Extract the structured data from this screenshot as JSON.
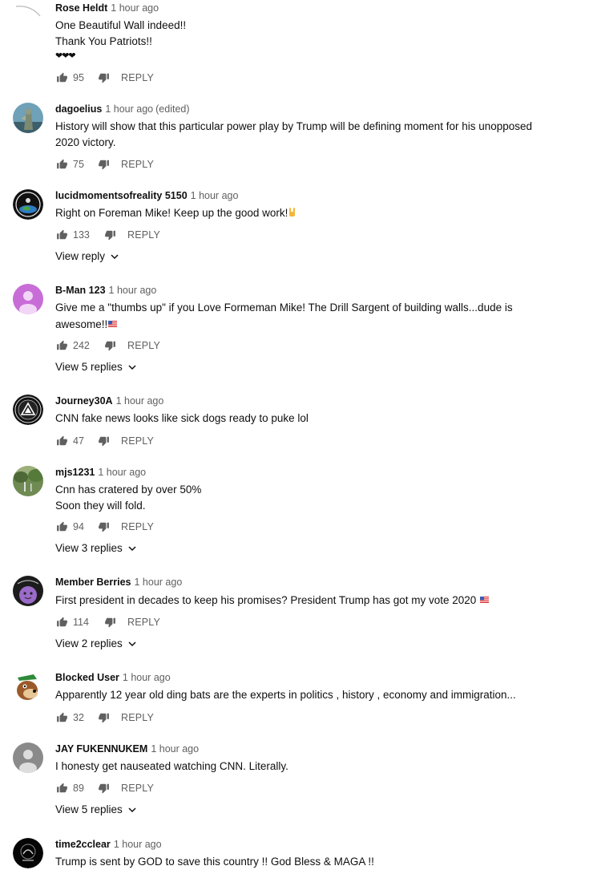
{
  "comments": [
    {
      "author": "Rose Heldt",
      "time": "1 hour ago",
      "edited": "",
      "lines": [
        "One Beautiful Wall indeed!!",
        "Thank You Patriots!!",
        "❤❤❤"
      ],
      "likes": "95",
      "reply_label": "REPLY",
      "view_replies": "",
      "avatar_icon": "partial-avatar-arc-icon"
    },
    {
      "author": "dagoelius",
      "time": "1 hour ago",
      "edited": "(edited)",
      "lines": [
        "History will show that this particular power play by Trump will be defining moment for his unopposed",
        "2020 victory."
      ],
      "likes": "75",
      "reply_label": "REPLY",
      "view_replies": "",
      "avatar_icon": "statue-photo-avatar"
    },
    {
      "author": "lucidmomentsofreality 5150",
      "time": "1 hour ago",
      "edited": "",
      "lines": [
        "Right on Foreman Mike! Keep up the good work!"
      ],
      "likes": "133",
      "reply_label": "REPLY",
      "view_replies": "View reply",
      "avatar_icon": "earth-logo-avatar"
    },
    {
      "author": "B-Man 123",
      "time": "1 hour ago",
      "edited": "",
      "lines": [
        "Give me a \"thumbs up\" if you Love Formeman Mike!  The Drill Sargent of building walls...dude is",
        "awesome!!"
      ],
      "likes": "242",
      "reply_label": "REPLY",
      "view_replies": "View 5 replies",
      "avatar_icon": "default-purple-avatar"
    },
    {
      "author": "Journey30A",
      "time": "1 hour ago",
      "edited": "",
      "lines": [
        "CNN fake news looks like sick dogs ready to puke lol"
      ],
      "likes": "47",
      "reply_label": "REPLY",
      "view_replies": "",
      "avatar_icon": "triangle-badge-avatar"
    },
    {
      "author": "mjs1231",
      "time": "1 hour ago",
      "edited": "",
      "lines": [
        "Cnn has cratered by over 50%",
        "Soon they will fold."
      ],
      "likes": "94",
      "reply_label": "REPLY",
      "view_replies": "View 3 replies",
      "avatar_icon": "landscape-photo-avatar"
    },
    {
      "author": "Member Berries",
      "time": "1 hour ago",
      "edited": "",
      "lines": [
        "First president in decades to keep his promises? President Trump has got my vote 2020"
      ],
      "likes": "114",
      "reply_label": "REPLY",
      "view_replies": "View 2 replies",
      "avatar_icon": "purple-berry-avatar"
    },
    {
      "author": "Blocked User",
      "time": "1 hour ago",
      "edited": "",
      "lines": [
        "Apparently 12 year old ding bats are the experts in politics , history , economy and immigration..."
      ],
      "likes": "32",
      "reply_label": "REPLY",
      "view_replies": "",
      "avatar_icon": "cartoon-bear-avatar"
    },
    {
      "author": "JAY FUKENNUKEM",
      "time": "1 hour ago",
      "edited": "",
      "lines": [
        "I honesty get nauseated watching CNN. Literally."
      ],
      "likes": "89",
      "reply_label": "REPLY",
      "view_replies": "View 5 replies",
      "avatar_icon": "default-gray-avatar"
    },
    {
      "author": "time2cclear",
      "time": "1 hour ago",
      "edited": "",
      "lines": [
        "Trump is sent by GOD to save this country !!  God Bless & MAGA !!"
      ],
      "likes": "",
      "reply_label": "",
      "view_replies": "",
      "avatar_icon": "dark-logo-avatar"
    }
  ],
  "colors": {
    "text_primary": "#0f0f0f",
    "text_secondary": "#606060",
    "default_avatar_purple": "#c86dd7",
    "default_avatar_gray": "#8a8a8a"
  }
}
